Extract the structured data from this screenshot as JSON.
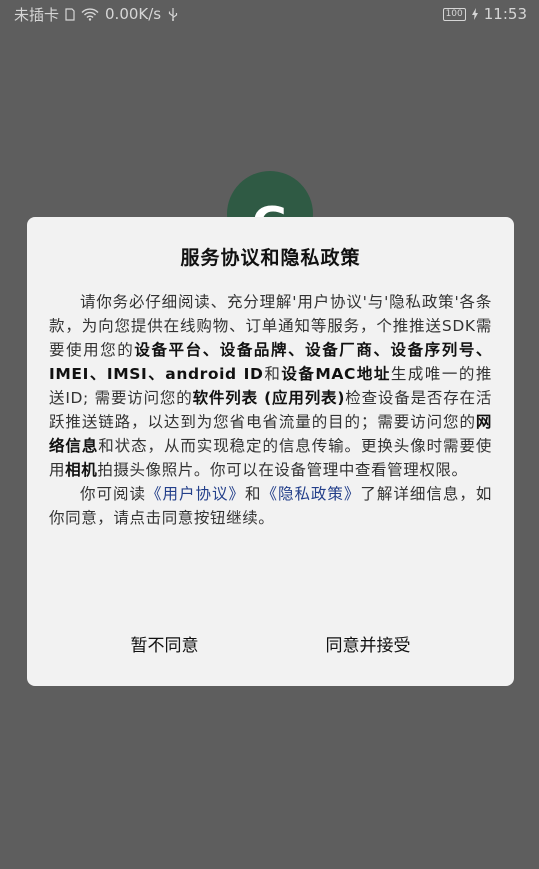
{
  "status_bar": {
    "carrier": "未插卡",
    "network_speed": "0.00K/s",
    "battery": "100",
    "time": "11:53"
  },
  "logo": {
    "letter": "G"
  },
  "dialog": {
    "title": "服务协议和隐私政策",
    "p1_a": "请你务必仔细阅读、充分理解'用户协议'与'隐私政策'各条款，为向您提供在线购物、订单通知等服务，个推推送SDK需要使用您的",
    "p1_b": "设备平台、设备品牌、设备厂商、设备序列号、IMEI、IMSI、android ID",
    "p1_c": "和",
    "p1_d": "设备MAC地址",
    "p1_e": "生成唯一的推送ID; 需要访问您的",
    "p1_f": "软件列表 (应用列表)",
    "p1_g": "检查设备是否存在活跃推送链路，以达到为您省电省流量的目的；需要访问您的",
    "p1_h": "网络信息",
    "p1_i": "和状态，从而实现稳定的信息传输。更换头像时需要使用",
    "p1_j": "相机",
    "p1_k": "拍摄头像照片。你可以在设备管理中查看管理权限。",
    "p2_a": "你可阅读",
    "p2_link1": "《用户协议》",
    "p2_b": "和",
    "p2_link2": "《隐私政策》",
    "p2_c": "了解详细信息，如你同意，请点击同意按钮继续。",
    "decline_label": "暂不同意",
    "accept_label": "同意并接受"
  }
}
